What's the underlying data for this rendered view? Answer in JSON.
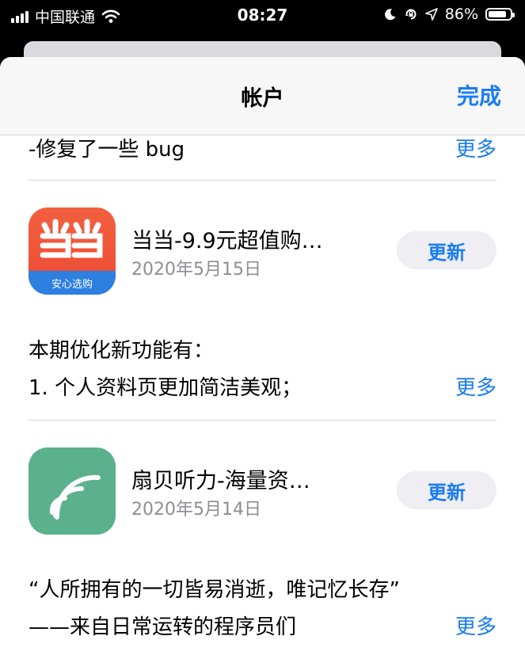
{
  "status_bar": {
    "carrier": "中国联通",
    "time": "08:27",
    "battery": "86%",
    "battery_level": 0.86
  },
  "nav": {
    "title": "帐户",
    "done_label": "完成"
  },
  "top_partial": {
    "notes": "-修复了一些 bug",
    "more_label": "更多"
  },
  "apps": [
    {
      "name": "当当-9.9元超值购…",
      "date": "2020年5月15日",
      "update_label": "更新",
      "icon_caption": "安心选购",
      "notes": [
        "本期优化新功能有：",
        "1. 个人资料页更加简洁美观；"
      ],
      "more_label": "更多",
      "icon_color": "#ec4a34"
    },
    {
      "name": "扇贝听力-海量资…",
      "date": "2020年5月14日",
      "update_label": "更新",
      "notes": [
        "“人所拥有的一切皆易消逝，唯记忆长存”",
        "——来自日常运转的程序员们"
      ],
      "more_label": "更多",
      "icon_color": "#5bb18d"
    }
  ],
  "colors": {
    "accent": "#1a7cf5",
    "secondary_text": "#8e8e93"
  }
}
